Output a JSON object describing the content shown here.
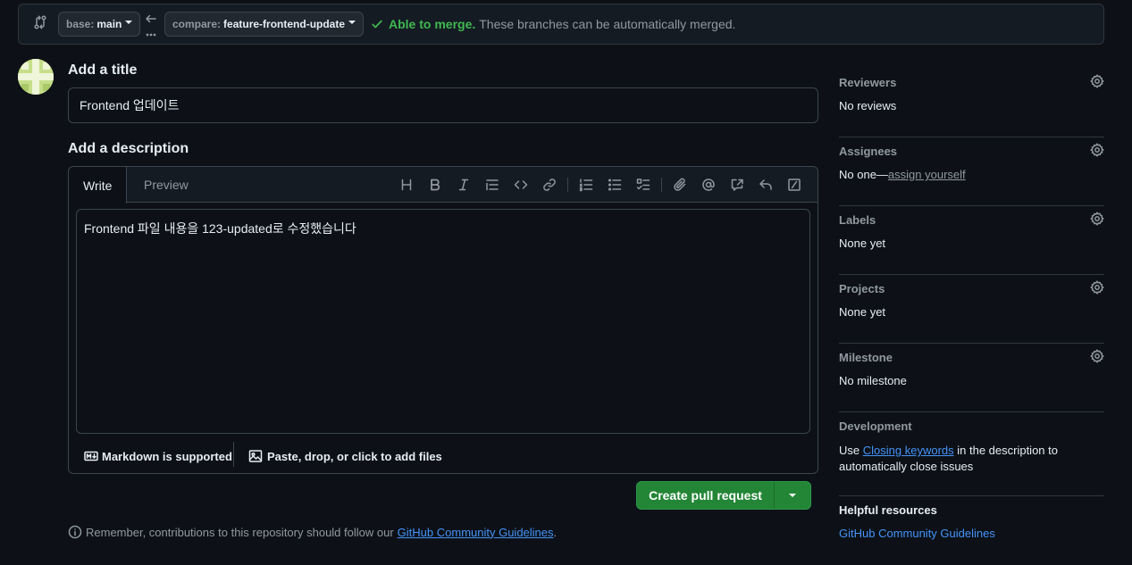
{
  "compare_bar": {
    "base_prefix": "base:",
    "base_branch": "main",
    "compare_prefix": "compare:",
    "compare_branch": "feature-frontend-update",
    "merge_ok": "Able to merge.",
    "merge_msg": "These branches can be automatically merged."
  },
  "form": {
    "title_heading": "Add a title",
    "title_value": "Frontend 업데이트",
    "description_heading": "Add a description",
    "tabs": [
      "Write",
      "Preview"
    ],
    "description_value": "Frontend 파일 내용을 123-updated로 수정했습니다",
    "markdown_note": "Markdown is supported",
    "attach_note": "Paste, drop, or click to add files",
    "submit_label": "Create pull request",
    "guidelines_prefix": "Remember, contributions to this repository should follow our",
    "guidelines_link": "GitHub Community Guidelines",
    "guidelines_suffix": "."
  },
  "toolbar_icons": [
    "heading-icon",
    "bold-icon",
    "italic-icon",
    "quote-icon",
    "code-icon",
    "link-icon",
    "ordered-list-icon",
    "unordered-list-icon",
    "task-list-icon",
    "attach-icon",
    "mention-icon",
    "reference-icon",
    "reply-icon",
    "slash-command-icon"
  ],
  "sidebar": {
    "reviewers": {
      "label": "Reviewers",
      "value": "No reviews"
    },
    "assignees": {
      "label": "Assignees",
      "value_prefix": "No one—",
      "value_link": "assign yourself"
    },
    "labels": {
      "label": "Labels",
      "value": "None yet"
    },
    "projects": {
      "label": "Projects",
      "value": "None yet"
    },
    "milestone": {
      "label": "Milestone",
      "value": "No milestone"
    },
    "development": {
      "label": "Development",
      "text_prefix": "Use",
      "link": "Closing keywords",
      "text_suffix": "in the description to automatically close issues"
    },
    "help": {
      "title": "Helpful resources",
      "link": "GitHub Community Guidelines"
    }
  },
  "colors": {
    "background": "#0d1117",
    "success": "#3fb950",
    "primary_button": "#238636",
    "link": "#4493f8",
    "muted": "#9198a1"
  }
}
